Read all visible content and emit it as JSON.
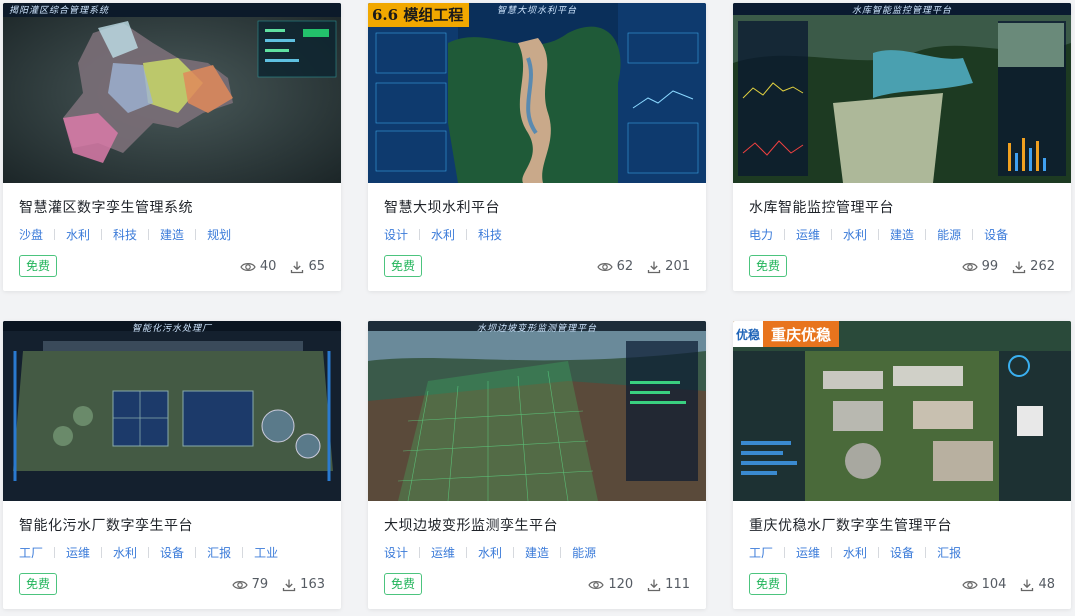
{
  "free_label": "免费",
  "cards": [
    {
      "title": "智慧灌区数字孪生管理系统",
      "tags": [
        "沙盘",
        "水利",
        "科技",
        "建造",
        "规划"
      ],
      "views": "40",
      "downloads": "65",
      "thumb_header": "揭阳灌区综合管理系统"
    },
    {
      "title": "智慧大坝水利平台",
      "tags": [
        "设计",
        "水利",
        "科技"
      ],
      "views": "62",
      "downloads": "201",
      "thumb_badge": "6.6",
      "thumb_badge_text": "模组工程",
      "thumb_header": "智慧大坝水利平台"
    },
    {
      "title": "水库智能监控管理平台",
      "tags": [
        "电力",
        "运维",
        "水利",
        "建造",
        "能源",
        "设备"
      ],
      "views": "99",
      "downloads": "262",
      "thumb_header": "水库智能监控管理平台"
    },
    {
      "title": "智能化污水厂数字孪生平台",
      "tags": [
        "工厂",
        "运维",
        "水利",
        "设备",
        "汇报",
        "工业"
      ],
      "views": "79",
      "downloads": "163",
      "thumb_header": "智能化污水处理厂"
    },
    {
      "title": "大坝边坡变形监测孪生平台",
      "tags": [
        "设计",
        "运维",
        "水利",
        "建造",
        "能源"
      ],
      "views": "120",
      "downloads": "111",
      "thumb_header": "水坝边坡变形监测管理平台"
    },
    {
      "title": "重庆优稳水厂数字孪生管理平台",
      "tags": [
        "工厂",
        "运维",
        "水利",
        "设备",
        "汇报"
      ],
      "views": "104",
      "downloads": "48",
      "thumb_badge_text": "重庆优稳",
      "thumb_logo": "优稳"
    }
  ]
}
